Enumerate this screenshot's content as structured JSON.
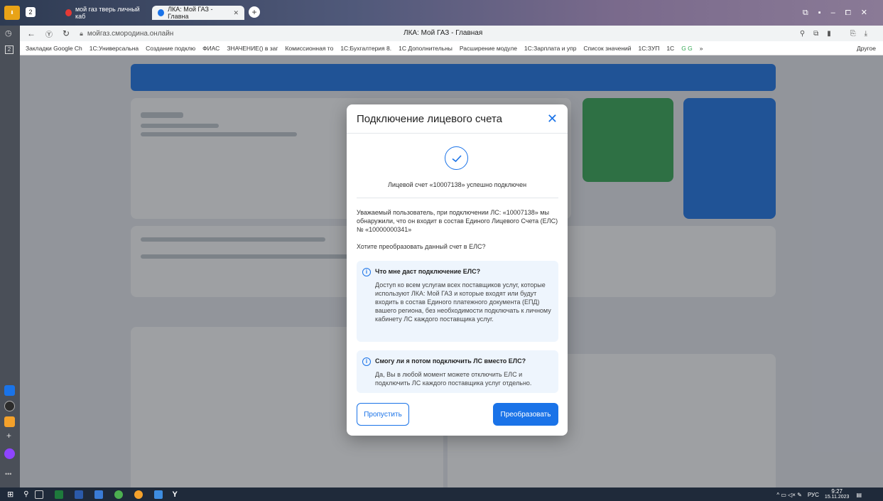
{
  "tabs": {
    "counter": "2",
    "tab1_label": "мой газ тверь личный каб",
    "tab2_label": "ЛКА: Мой ГАЗ - Главна",
    "new_tab": "+"
  },
  "urlbar": {
    "url": "мойгаз.смородина.онлайн",
    "page_title": "ЛКА: Мой ГАЗ - Главная"
  },
  "bookmarks": [
    "Закладки Google Ch",
    "1С:Универсальна",
    "Создание подклю",
    "ФИАС",
    "ЗНАЧЕНИЕ() в заг",
    "Комиссионная то",
    "1С:Бухгалтерия 8.",
    "1С Дополнительны",
    "Расширение модуле",
    "1С:Зарплата и упр",
    "Список значений",
    "1С:ЗУП",
    "1С",
    "G G",
    "»",
    "Другое"
  ],
  "modal": {
    "title": "Подключение лицевого счета",
    "success": "Лицевой счет «10007138» успешно подключен",
    "paragraph1": "Уважаемый пользователь, при подключении ЛС: «10007138» мы обнаружили, что он входит в состав Единого Лицевого Счета (ЕЛС) № «10000000341»",
    "paragraph2": "Хотите преобразовать данный счет в ЕЛС?",
    "info1_title": "Что мне даст подключение ЕЛС?",
    "info1_body": "Доступ ко всем услугам всех поставщиков услуг, которые используют ЛКА: Мой ГАЗ и которые входят или будут входить в состав Единого платежного документа (ЕПД) вашего региона, без необходимости подключать к личному кабинету ЛС каждого поставщика услуг.",
    "info2_title": "Смогу ли я потом подключить ЛС вместо ЕЛС?",
    "info2_body": "Да, Вы в любой момент можете отключить ЕЛС и подключить ЛС каждого поставщика услуг отдельно.",
    "skip_button": "Пропустить",
    "convert_button": "Преобразовать"
  },
  "taskbar": {
    "lang": "РУС",
    "time": "9:27",
    "date": "15.11.2023"
  },
  "colors": {
    "accent": "#1a73e8",
    "green_tile": "#34a853"
  }
}
